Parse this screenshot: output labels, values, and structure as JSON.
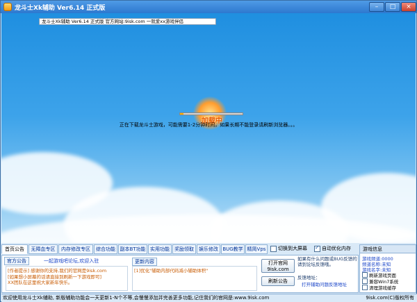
{
  "window": {
    "title": "龙斗士Xk辅助 Ver6.14 正式版",
    "min_label": "–",
    "max_label": "□",
    "close_label": "×"
  },
  "sky": {
    "info_strip": "龙斗士Xk辅助 Ver6.14 正式版        官方网站:9isk.com    一就爱xx游戏伴侣",
    "loader_label": "加载中",
    "progress": 0.05,
    "loading_message": "正在下载龙斗士游戏，可能需要1-2分钟时间，如果长期不能登录请刷新浏览器。。。"
  },
  "tabs": [
    {
      "label": "首页公告",
      "active": true
    },
    {
      "label": "无障血专区",
      "active": false
    },
    {
      "label": "内存修改专区",
      "active": false
    },
    {
      "label": "综合功能",
      "active": false
    },
    {
      "label": "副本BT功能",
      "active": false
    },
    {
      "label": "实用功能",
      "active": false
    },
    {
      "label": "奖励领取",
      "active": false
    },
    {
      "label": "娱乐修改",
      "active": false
    },
    {
      "label": "BUG教学",
      "active": false
    },
    {
      "label": "精简Vps",
      "active": false
    }
  ],
  "options": {
    "big_screen": {
      "label": "切换到大屏幕",
      "checked": false
    },
    "auto_memory": {
      "label": "自动优化内存",
      "checked": true
    }
  },
  "home": {
    "subtab_notice": "官方公告",
    "forum_link": "一起游戏吧论坛,欢迎入驻",
    "notice_lines": [
      "[作者提示] 感谢你的支持,我们的官网是9isk.com",
      "[如果想小屏幕的话请直接到刷新一下游戏即可]",
      "XX团队在这里祝大家新年快乐。"
    ],
    "subtab_update": "更新内容",
    "update_text": "[1]优化\"辅助内部代码减小辅助体积\"",
    "official_button_line1": "打开官网",
    "official_button_line2": "9isk.com",
    "refresh_button": "刷新公告",
    "feedback_text": "如果有什么问题或BUG反馈的请到论坛反馈哦。",
    "feedback_label": "反馈地址：",
    "feedback_link": "打开辅助问题反馈地址"
  },
  "side_panel": {
    "header": "游戏信息",
    "lines": [
      "游戏频道:0000",
      "频道名称:未知",
      "游戏名字:未知"
    ],
    "checks": [
      {
        "label": "刷新游戏页面",
        "checked": false
      },
      {
        "label": "兼容Win7系统",
        "checked": false
      },
      {
        "label": "清理游戏缓存",
        "checked": false
      }
    ]
  },
  "status": {
    "text": "欢迎使用龙斗士Xk辅助, 新版辅助功能会一天更新1-N个不等,会慢慢添加并完善更多功能,记住我们的官网是:www.9isk.com",
    "copyright": "9isk.com(C)版权所有"
  }
}
